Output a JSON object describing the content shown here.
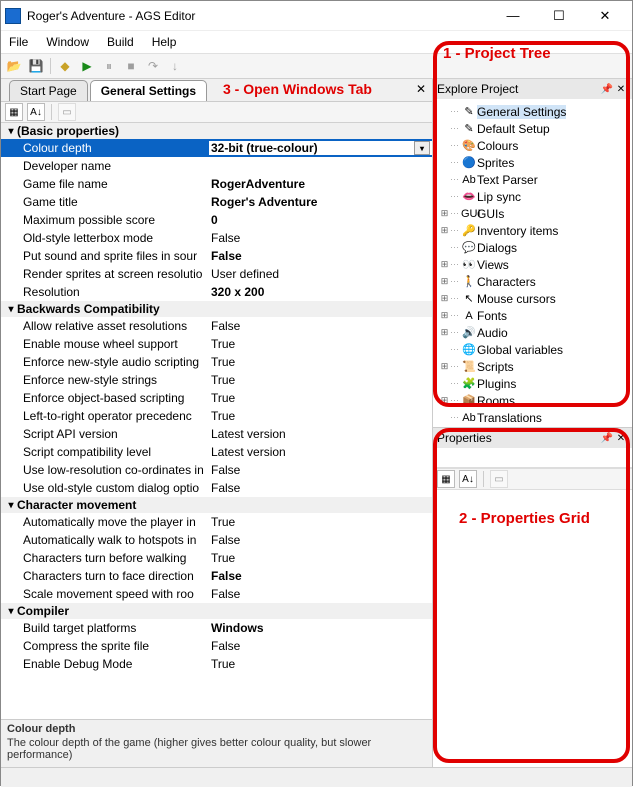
{
  "window": {
    "title": "Roger's Adventure - AGS Editor",
    "minimize": "—",
    "maximize": "☐",
    "close": "✕"
  },
  "menu": {
    "file": "File",
    "window": "Window",
    "build": "Build",
    "help": "Help"
  },
  "tabs": {
    "start": "Start Page",
    "general": "General Settings"
  },
  "annotations": {
    "a1": "1 - Project Tree",
    "a2": "2 - Properties Grid",
    "a3": "3 - Open Windows Tab"
  },
  "explore": {
    "title": "Explore Project",
    "items": [
      {
        "exp": "",
        "ico": "✎",
        "label": "General Settings",
        "sel": true
      },
      {
        "exp": "",
        "ico": "✎",
        "label": "Default Setup"
      },
      {
        "exp": "",
        "ico": "🎨",
        "label": "Colours"
      },
      {
        "exp": "",
        "ico": "🔵",
        "label": "Sprites"
      },
      {
        "exp": "",
        "ico": "Ab",
        "label": "Text Parser"
      },
      {
        "exp": "",
        "ico": "👄",
        "label": "Lip sync"
      },
      {
        "exp": "⊞",
        "ico": "GUI",
        "label": "GUIs"
      },
      {
        "exp": "⊞",
        "ico": "🔑",
        "label": "Inventory items"
      },
      {
        "exp": "",
        "ico": "💬",
        "label": "Dialogs"
      },
      {
        "exp": "⊞",
        "ico": "👀",
        "label": "Views"
      },
      {
        "exp": "⊞",
        "ico": "🚶",
        "label": "Characters"
      },
      {
        "exp": "⊞",
        "ico": "↖",
        "label": "Mouse cursors"
      },
      {
        "exp": "⊞",
        "ico": "A",
        "label": "Fonts"
      },
      {
        "exp": "⊞",
        "ico": "🔊",
        "label": "Audio"
      },
      {
        "exp": "",
        "ico": "🌐",
        "label": "Global variables"
      },
      {
        "exp": "⊞",
        "ico": "📜",
        "label": "Scripts"
      },
      {
        "exp": "",
        "ico": "🧩",
        "label": "Plugins"
      },
      {
        "exp": "⊞",
        "ico": "📦",
        "label": "Rooms"
      },
      {
        "exp": "",
        "ico": "Ab",
        "label": "Translations"
      }
    ]
  },
  "propsPanel": {
    "title": "Properties"
  },
  "categories": [
    {
      "name": "(Basic properties)",
      "rows": [
        {
          "name": "Colour depth",
          "val": "32-bit (true-colour)",
          "bold": true,
          "sel": true
        },
        {
          "name": "Developer name",
          "val": ""
        },
        {
          "name": "Game file name",
          "val": "RogerAdventure",
          "bold": true
        },
        {
          "name": "Game title",
          "val": "Roger's Adventure",
          "bold": true
        },
        {
          "name": "Maximum possible score",
          "val": "0",
          "bold": true
        },
        {
          "name": "Old-style letterbox mode",
          "val": "False"
        },
        {
          "name": "Put sound and sprite files in sour",
          "val": "False",
          "bold": true
        },
        {
          "name": "Render sprites at screen resolutio",
          "val": "User defined"
        },
        {
          "name": "Resolution",
          "val": "320 x 200",
          "bold": true
        }
      ]
    },
    {
      "name": "Backwards Compatibility",
      "rows": [
        {
          "name": "Allow relative asset resolutions",
          "val": "False"
        },
        {
          "name": "Enable mouse wheel support",
          "val": "True"
        },
        {
          "name": "Enforce new-style audio scripting",
          "val": "True"
        },
        {
          "name": "Enforce new-style strings",
          "val": "True"
        },
        {
          "name": "Enforce object-based scripting",
          "val": "True"
        },
        {
          "name": "Left-to-right operator precedenc",
          "val": "True"
        },
        {
          "name": "Script API version",
          "val": "Latest version"
        },
        {
          "name": "Script compatibility level",
          "val": "Latest version"
        },
        {
          "name": "Use low-resolution co-ordinates in",
          "val": "False"
        },
        {
          "name": "Use old-style custom dialog optio",
          "val": "False"
        }
      ]
    },
    {
      "name": "Character movement",
      "rows": [
        {
          "name": "Automatically move the player in",
          "val": "True"
        },
        {
          "name": "Automatically walk to hotspots in",
          "val": "False"
        },
        {
          "name": "Characters turn before walking",
          "val": "True"
        },
        {
          "name": "Characters turn to face direction",
          "val": "False",
          "bold": true
        },
        {
          "name": "Scale movement speed with roo",
          "val": "False"
        }
      ]
    },
    {
      "name": "Compiler",
      "rows": [
        {
          "name": "Build target platforms",
          "val": "Windows",
          "bold": true
        },
        {
          "name": "Compress the sprite file",
          "val": "False"
        },
        {
          "name": "Enable Debug Mode",
          "val": "True"
        }
      ]
    }
  ],
  "description": {
    "title": "Colour depth",
    "text": "The colour depth of the game (higher gives better colour quality, but slower performance)"
  }
}
